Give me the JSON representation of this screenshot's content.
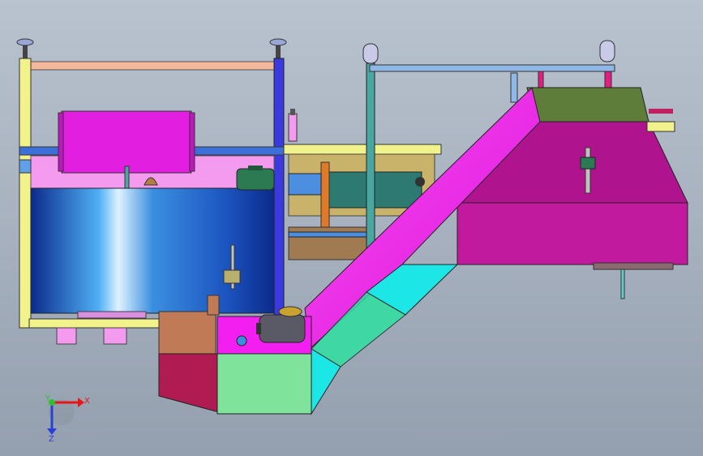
{
  "viewport": {
    "background_top": "#b9c3cf",
    "background_bottom": "#949faf"
  },
  "triad": {
    "x_label": "X",
    "y_label": "Y",
    "z_label": "Z",
    "x_color": "#e8161b",
    "y_color": "#2fbf2f",
    "z_color": "#2a3fd8"
  },
  "parts": {
    "frame": "#f2f28c",
    "frame_post": "#3a3ae0",
    "top_rail": "#f4b79a",
    "magenta_box": "#e21ee0",
    "blue_drum": "#1f5fd0",
    "pink_bin": "#f49bf0",
    "conveyor": "#f21ff0",
    "hopper": "#c21a9e",
    "hopper_top": "#5e7d3a",
    "green_panel": "#7fe39c",
    "cyan_panel": "#1de6e6",
    "motor": "#5a5a66",
    "dark_red": "#b01b52",
    "brown": "#c07a56",
    "teal_pipe": "#4aa6a0",
    "blue_pipe": "#8fb8e8"
  }
}
